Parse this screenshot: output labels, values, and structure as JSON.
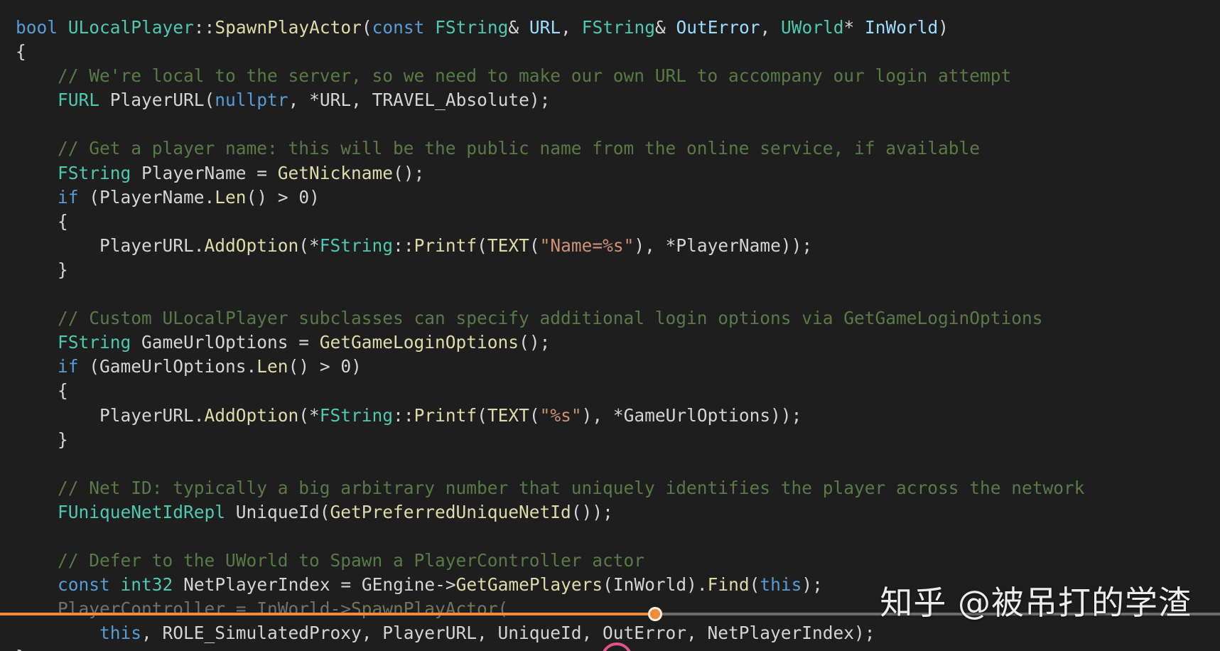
{
  "code_lines": [
    [
      {
        "t": "bool",
        "c": "k"
      },
      {
        "t": " ",
        "c": ""
      },
      {
        "t": "ULocalPlayer",
        "c": "t"
      },
      {
        "t": "::",
        "c": ""
      },
      {
        "t": "SpawnPlayActor",
        "c": "f"
      },
      {
        "t": "(",
        "c": ""
      },
      {
        "t": "const",
        "c": "k"
      },
      {
        "t": " ",
        "c": ""
      },
      {
        "t": "FString",
        "c": "t"
      },
      {
        "t": "& ",
        "c": ""
      },
      {
        "t": "URL",
        "c": "v"
      },
      {
        "t": ", ",
        "c": ""
      },
      {
        "t": "FString",
        "c": "t"
      },
      {
        "t": "& ",
        "c": ""
      },
      {
        "t": "OutError",
        "c": "v"
      },
      {
        "t": ", ",
        "c": ""
      },
      {
        "t": "UWorld",
        "c": "t"
      },
      {
        "t": "* ",
        "c": ""
      },
      {
        "t": "InWorld",
        "c": "v"
      },
      {
        "t": ")",
        "c": ""
      }
    ],
    [
      {
        "t": "{",
        "c": ""
      }
    ],
    [
      {
        "t": "    // We're local to the server, so we need to make our own URL to accompany our login attempt",
        "c": "c"
      }
    ],
    [
      {
        "t": "    ",
        "c": ""
      },
      {
        "t": "FURL",
        "c": "t"
      },
      {
        "t": " PlayerURL(",
        "c": ""
      },
      {
        "t": "nullptr",
        "c": "k"
      },
      {
        "t": ", *URL, TRAVEL_Absolute);",
        "c": ""
      }
    ],
    [
      {
        "t": "",
        "c": ""
      }
    ],
    [
      {
        "t": "    // Get a player name: this will be the public name from the online service, if available",
        "c": "c"
      }
    ],
    [
      {
        "t": "    ",
        "c": ""
      },
      {
        "t": "FString",
        "c": "t"
      },
      {
        "t": " PlayerName = ",
        "c": ""
      },
      {
        "t": "GetNickname",
        "c": "f"
      },
      {
        "t": "();",
        "c": ""
      }
    ],
    [
      {
        "t": "    ",
        "c": ""
      },
      {
        "t": "if",
        "c": "k"
      },
      {
        "t": " (PlayerName.",
        "c": ""
      },
      {
        "t": "Len",
        "c": "f"
      },
      {
        "t": "() > 0)",
        "c": ""
      }
    ],
    [
      {
        "t": "    {",
        "c": ""
      }
    ],
    [
      {
        "t": "        PlayerURL.",
        "c": ""
      },
      {
        "t": "AddOption",
        "c": "f"
      },
      {
        "t": "(*",
        "c": ""
      },
      {
        "t": "FString",
        "c": "t"
      },
      {
        "t": "::",
        "c": ""
      },
      {
        "t": "Printf",
        "c": "f"
      },
      {
        "t": "(",
        "c": ""
      },
      {
        "t": "TEXT",
        "c": "f"
      },
      {
        "t": "(",
        "c": ""
      },
      {
        "t": "\"Name=%s\"",
        "c": "s"
      },
      {
        "t": "), *PlayerName));",
        "c": ""
      }
    ],
    [
      {
        "t": "    }",
        "c": ""
      }
    ],
    [
      {
        "t": "",
        "c": ""
      }
    ],
    [
      {
        "t": "    // Custom ULocalPlayer subclasses can specify additional login options via GetGameLoginOptions",
        "c": "c"
      }
    ],
    [
      {
        "t": "    ",
        "c": ""
      },
      {
        "t": "FString",
        "c": "t"
      },
      {
        "t": " GameUrlOptions = ",
        "c": ""
      },
      {
        "t": "GetGameLoginOptions",
        "c": "f"
      },
      {
        "t": "();",
        "c": ""
      }
    ],
    [
      {
        "t": "    ",
        "c": ""
      },
      {
        "t": "if",
        "c": "k"
      },
      {
        "t": " (GameUrlOptions.",
        "c": ""
      },
      {
        "t": "Len",
        "c": "f"
      },
      {
        "t": "() > 0)",
        "c": ""
      }
    ],
    [
      {
        "t": "    {",
        "c": ""
      }
    ],
    [
      {
        "t": "        PlayerURL.",
        "c": ""
      },
      {
        "t": "AddOption",
        "c": "f"
      },
      {
        "t": "(*",
        "c": ""
      },
      {
        "t": "FString",
        "c": "t"
      },
      {
        "t": "::",
        "c": ""
      },
      {
        "t": "Printf",
        "c": "f"
      },
      {
        "t": "(",
        "c": ""
      },
      {
        "t": "TEXT",
        "c": "f"
      },
      {
        "t": "(",
        "c": ""
      },
      {
        "t": "\"%s\"",
        "c": "s"
      },
      {
        "t": "), *GameUrlOptions));",
        "c": ""
      }
    ],
    [
      {
        "t": "    }",
        "c": ""
      }
    ],
    [
      {
        "t": "",
        "c": ""
      }
    ],
    [
      {
        "t": "    // Net ID: typically a big arbitrary number that uniquely identifies the player across the network",
        "c": "c"
      }
    ],
    [
      {
        "t": "    ",
        "c": ""
      },
      {
        "t": "FUniqueNetIdRepl",
        "c": "t"
      },
      {
        "t": " UniqueId(",
        "c": ""
      },
      {
        "t": "GetPreferredUniqueNetId",
        "c": "f"
      },
      {
        "t": "());",
        "c": ""
      }
    ],
    [
      {
        "t": "",
        "c": ""
      }
    ],
    [
      {
        "t": "    // Defer to the UWorld to Spawn a PlayerController actor",
        "c": "c"
      }
    ],
    [
      {
        "t": "    ",
        "c": ""
      },
      {
        "t": "const",
        "c": "k"
      },
      {
        "t": " ",
        "c": ""
      },
      {
        "t": "int32",
        "c": "t"
      },
      {
        "t": " NetPlayerIndex = GEngine->",
        "c": ""
      },
      {
        "t": "GetGamePlayers",
        "c": "f"
      },
      {
        "t": "(InWorld).",
        "c": ""
      },
      {
        "t": "Find",
        "c": "f"
      },
      {
        "t": "(",
        "c": ""
      },
      {
        "t": "this",
        "c": "k"
      },
      {
        "t": ");",
        "c": ""
      }
    ],
    [
      {
        "t": "    PlayerController = InWorld->",
        "c": "faded"
      },
      {
        "t": "SpawnPlayActor",
        "c": "f faded"
      },
      {
        "t": "(",
        "c": "faded"
      }
    ],
    [
      {
        "t": "        ",
        "c": ""
      },
      {
        "t": "this",
        "c": "k"
      },
      {
        "t": ", ROLE_SimulatedProxy, PlayerURL, UniqueId, OutError, NetPlayerIndex);",
        "c": ""
      }
    ],
    [
      {
        "t": "}",
        "c": ""
      }
    ]
  ],
  "video_progress": 0.537,
  "watermark": "知乎 @被吊打的学渣",
  "colors": {
    "background": "#1e1e1e",
    "keyword": "#569cd6",
    "type": "#4ec9b0",
    "function": "#dcdcaa",
    "param": "#9cdcfe",
    "comment": "#6a9955",
    "string": "#ce9178",
    "progress": "#f08a3c"
  }
}
